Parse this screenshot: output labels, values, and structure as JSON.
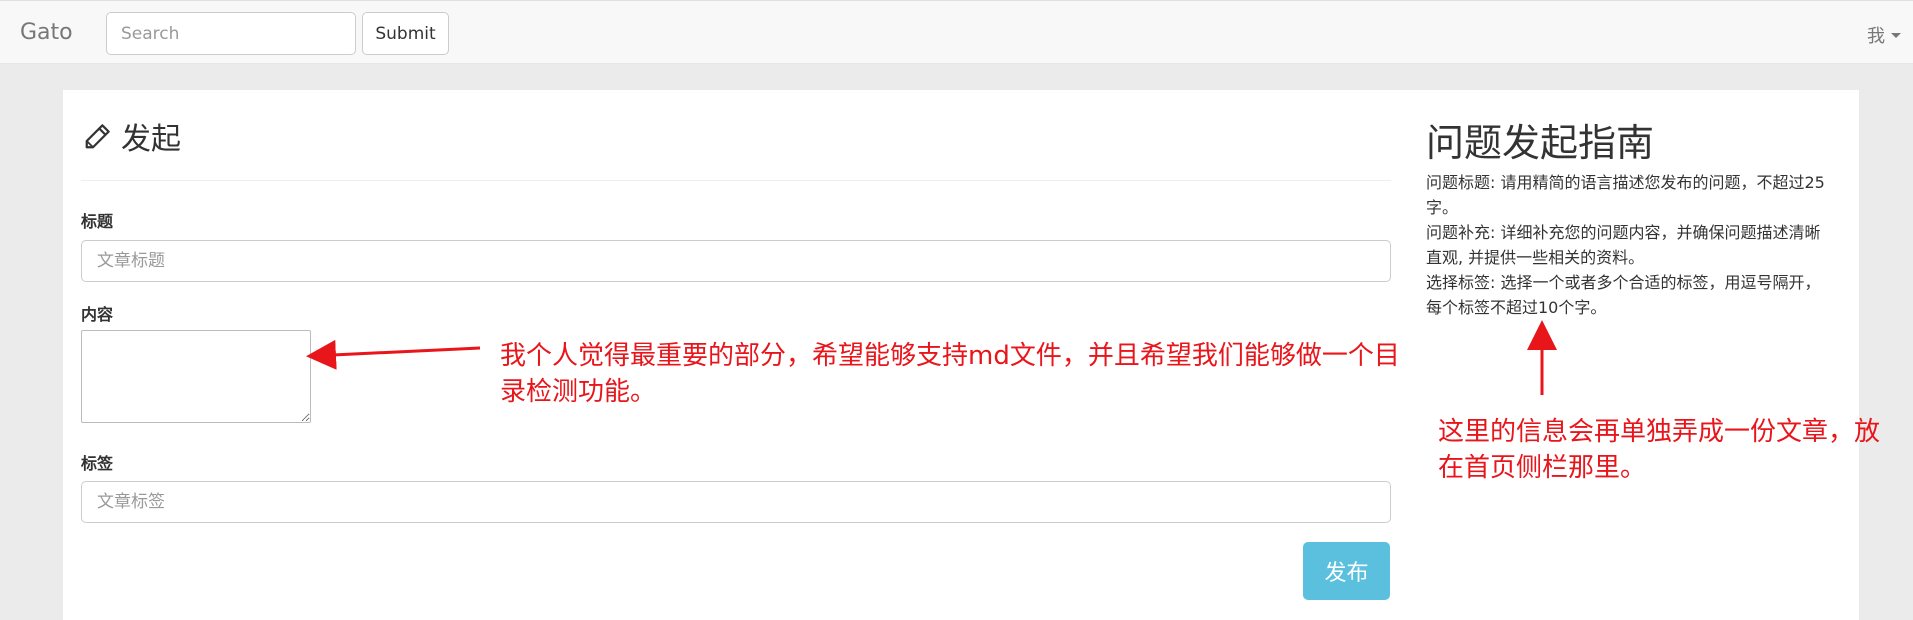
{
  "navbar": {
    "brand": "Gato",
    "search_placeholder": "Search",
    "submit_label": "Submit",
    "user_label": "我"
  },
  "form": {
    "page_title": "发起",
    "title_label": "标题",
    "title_placeholder": "文章标题",
    "content_label": "内容",
    "tags_label": "标签",
    "tags_placeholder": "文章标签",
    "publish_label": "发布"
  },
  "guide": {
    "heading": "问题发起指南",
    "lines": [
      "问题标题: 请用精简的语言描述您发布的问题，不超过25字。",
      "问题补充: 详细补充您的问题内容，并确保问题描述清晰直观, 并提供一些相关的资料。",
      "选择标签: 选择一个或者多个合适的标签，用逗号隔开，每个标签不超过10个字。"
    ]
  },
  "annotations": {
    "content_note": "我个人觉得最重要的部分，希望能够支持md文件，并且希望我们能够做一个目录检测功能。",
    "guide_note": "这里的信息会再单独弄成一份文章，放在首页侧栏那里。",
    "color": "#e8151b"
  },
  "colors": {
    "publish_button": "#5bc0de",
    "background": "#ebebeb"
  }
}
